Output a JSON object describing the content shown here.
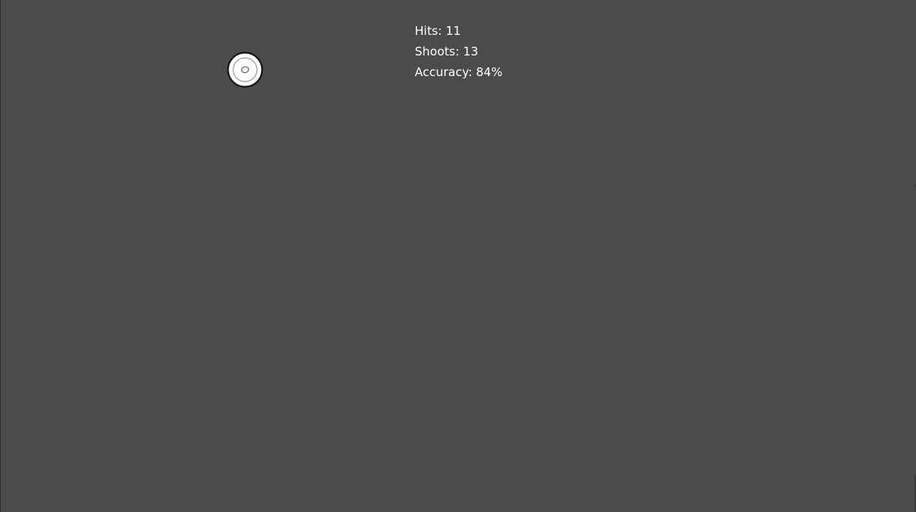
{
  "hud": {
    "hits_label": "Hits:",
    "hits_value": "11",
    "shoots_label": "Shoots:",
    "shoots_value": "13",
    "accuracy_label": "Accuracy:",
    "accuracy_value": "84%"
  },
  "colors": {
    "background": "#4b4b4b",
    "text": "#ffffff",
    "target_fill": "#ffffff",
    "target_outline": "#111111",
    "target_ring": "#9a9a9a"
  },
  "icons": {
    "target": "target-icon"
  }
}
